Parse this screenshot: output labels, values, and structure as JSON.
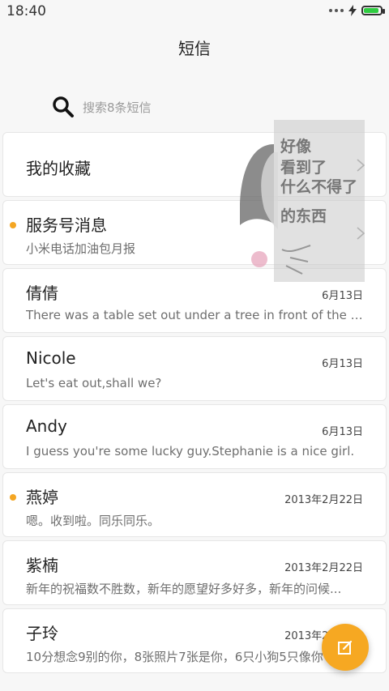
{
  "status_bar": {
    "time": "18:40",
    "icons": [
      "more-dots-icon",
      "charging-bolt-icon",
      "battery-icon"
    ],
    "battery_level_pct": 90,
    "battery_color": "#2ecc40"
  },
  "header": {
    "title": "短信"
  },
  "search": {
    "placeholder": "搜索8条短信",
    "icon": "search-icon"
  },
  "conversations": [
    {
      "name": "我的收藏",
      "preview": "",
      "date": "",
      "unread": false,
      "chevron": true
    },
    {
      "name": "服务号消息",
      "preview": "小米电话加油包月报",
      "date": "",
      "unread": true,
      "chevron": true
    },
    {
      "name": "倩倩",
      "preview": "There was a table set out under a tree in front of the ho...",
      "date": "6月13日",
      "unread": false
    },
    {
      "name": "Nicole",
      "preview": "Let's eat out,shall we?",
      "date": "6月13日",
      "unread": false
    },
    {
      "name": "Andy",
      "preview": "I guess you're some lucky guy.Stephanie is a nice girl.",
      "date": "6月13日",
      "unread": false
    },
    {
      "name": "燕婷",
      "preview": "嗯。收到啦。同乐同乐。",
      "date": "2013年2月22日",
      "unread": true
    },
    {
      "name": "紫楠",
      "preview": "新年的祝福数不胜数，新年的愿望好多好多，新年的问候...",
      "date": "2013年2月22日",
      "unread": false
    },
    {
      "name": "子玲",
      "preview": "10分想念9别的你，8张照片7张是你，6只小狗5只像你",
      "date": "2013年2月22日",
      "unread": false
    }
  ],
  "sticker": {
    "lines": [
      "好像",
      "看到了",
      "什么不得了",
      "的东西"
    ]
  },
  "fab": {
    "icon": "compose-icon",
    "color": "#f6a822"
  },
  "colors": {
    "accent": "#f4a623",
    "background": "#f7f7f7"
  }
}
